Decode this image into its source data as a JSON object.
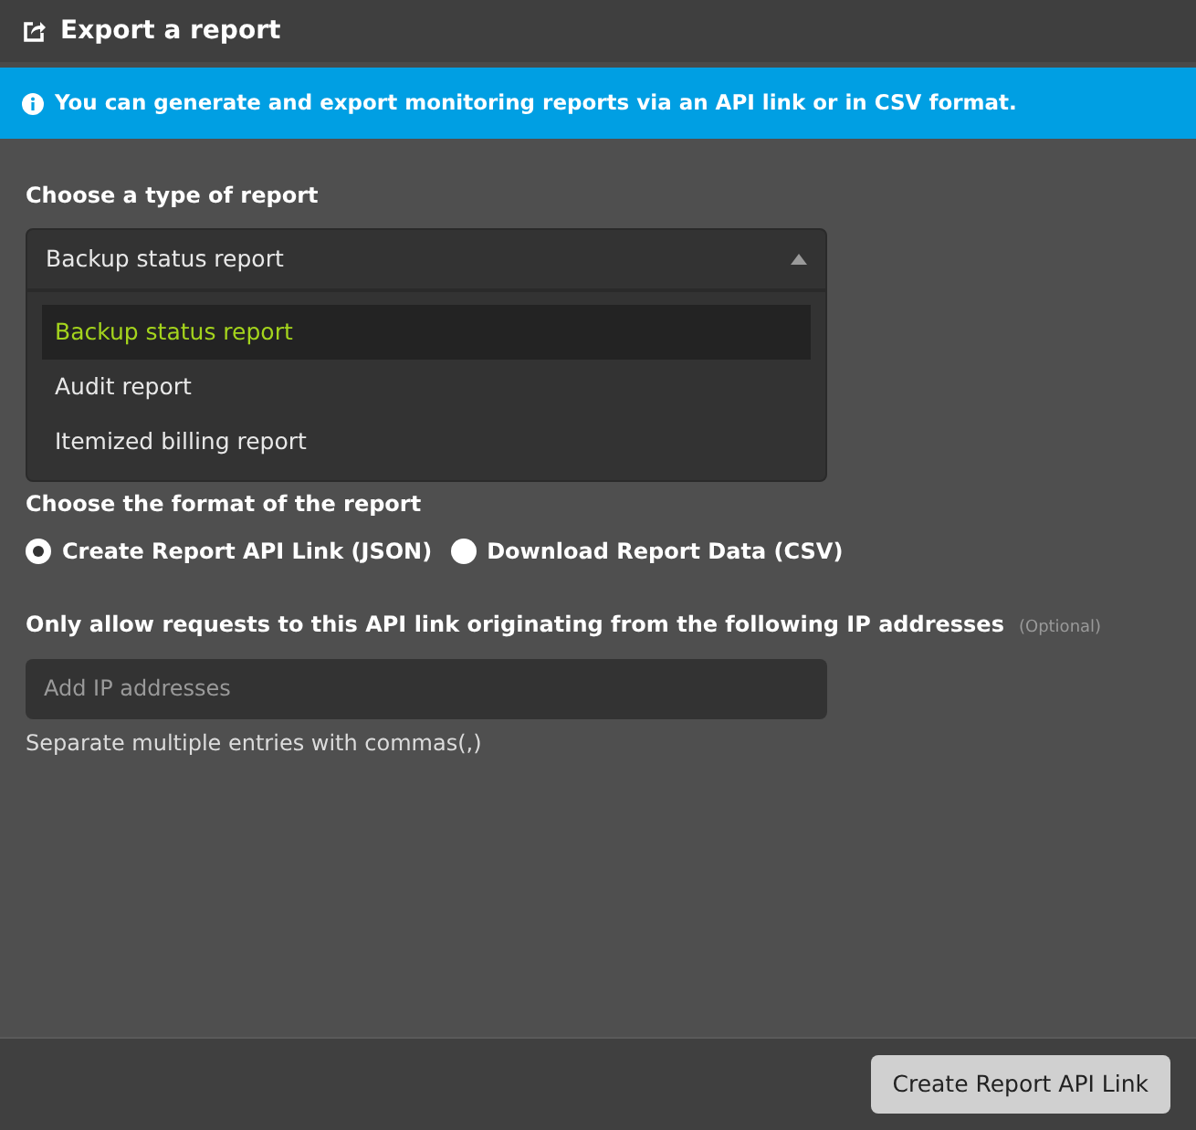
{
  "window": {
    "title": "Export a report"
  },
  "info_banner": {
    "text": "You can generate and export monitoring reports via an API link or in CSV format."
  },
  "report_type": {
    "label": "Choose a type of report",
    "value": "Backup status report",
    "expanded": true,
    "options": [
      {
        "label": "Backup status report",
        "selected": true
      },
      {
        "label": "Audit report",
        "selected": false
      },
      {
        "label": "Itemized billing report",
        "selected": false
      }
    ]
  },
  "format": {
    "label": "Choose the format of the report",
    "options": [
      {
        "label": "Create Report API Link (JSON)",
        "selected": true
      },
      {
        "label": "Download Report Data (CSV)",
        "selected": false
      }
    ]
  },
  "ip_filter": {
    "label": "Only allow requests to this API link originating from the following IP addresses",
    "optional": "(Optional)",
    "placeholder": "Add IP addresses",
    "help": "Separate multiple entries with commas(,)"
  },
  "footer": {
    "button": "Create Report API Link"
  }
}
